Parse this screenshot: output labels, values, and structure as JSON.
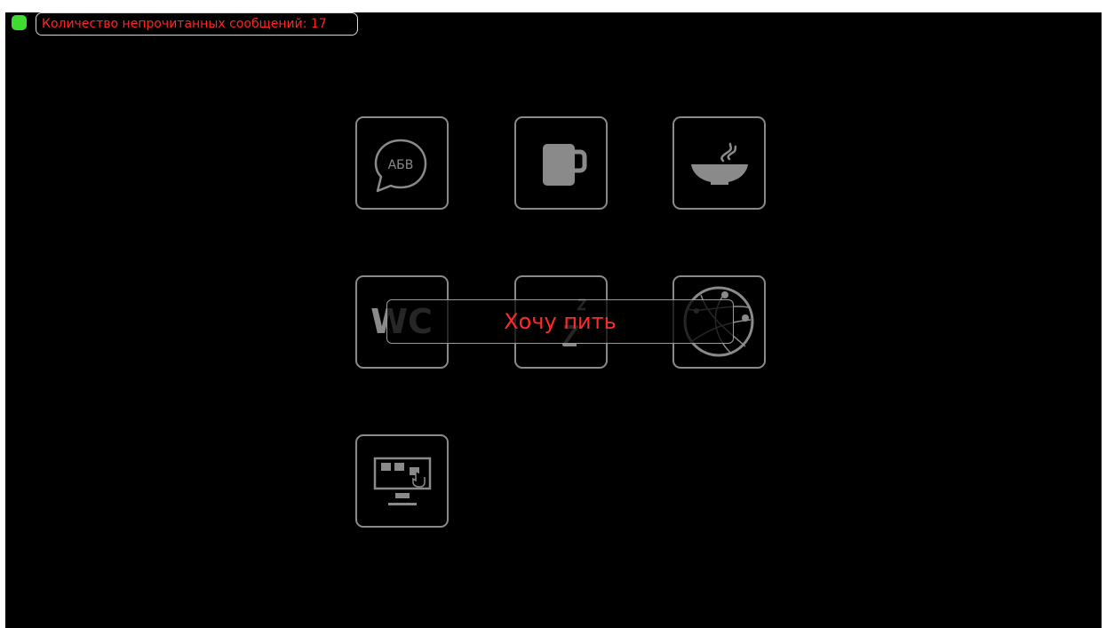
{
  "status": {
    "indicator_color": "#3ddc2f",
    "unread_text": "Количество непрочитанных сообщений: 17"
  },
  "tiles": [
    {
      "icon": "speech-bubble-icon",
      "label": "АБВ"
    },
    {
      "icon": "mug-icon"
    },
    {
      "icon": "soup-bowl-icon"
    },
    {
      "icon": "wc-icon",
      "label": "WC"
    },
    {
      "icon": "sleep-icon"
    },
    {
      "icon": "globe-icon"
    },
    {
      "icon": "monitor-touch-icon"
    }
  ],
  "overlay": {
    "text": "Хочу пить",
    "text_color": "#ff2a2a"
  },
  "colors": {
    "background": "#000000",
    "tile_border": "#8a8a8a",
    "icon_fill": "#8a8a8a"
  }
}
